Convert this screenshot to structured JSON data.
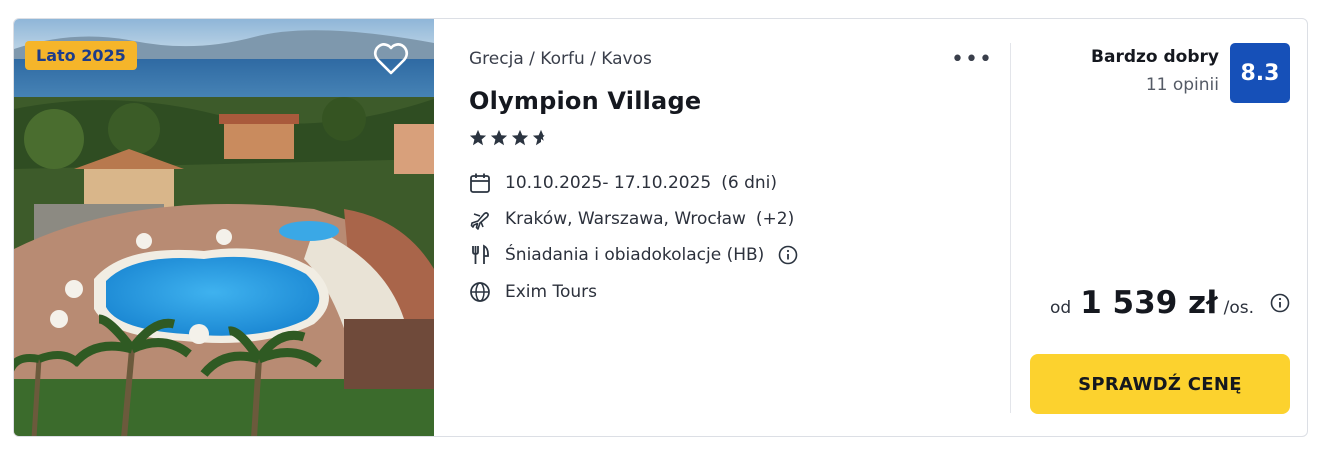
{
  "offer": {
    "badge": "Lato 2025",
    "breadcrumb": "Grecja / Korfu / Kavos",
    "hotel_name": "Olympion Village",
    "stars": 3.5,
    "dates": "10.10.2025- 17.10.2025",
    "duration": "(6 dni)",
    "departure": "Kraków, Warszawa, Wrocław",
    "departure_extra": "(+2)",
    "board": "Śniadania i obiadokolacje (HB)",
    "operator": "Exim Tours",
    "more_label": "•••"
  },
  "rating": {
    "label": "Bardzo dobry",
    "reviews": "11 opinii",
    "score": "8.3"
  },
  "price": {
    "prefix": "od",
    "amount": "1 539 zł",
    "suffix": "/os."
  },
  "cta": {
    "label": "SPRAWDŹ CENĘ"
  },
  "colors": {
    "badge_bg": "#f5b52a",
    "badge_text": "#1d3c8a",
    "score_bg": "#1650b8",
    "cta_bg": "#fcd22e"
  },
  "icons": [
    "heart-icon",
    "more-icon",
    "star-icon",
    "calendar-icon",
    "plane-icon",
    "meal-icon",
    "info-icon",
    "globe-icon"
  ]
}
